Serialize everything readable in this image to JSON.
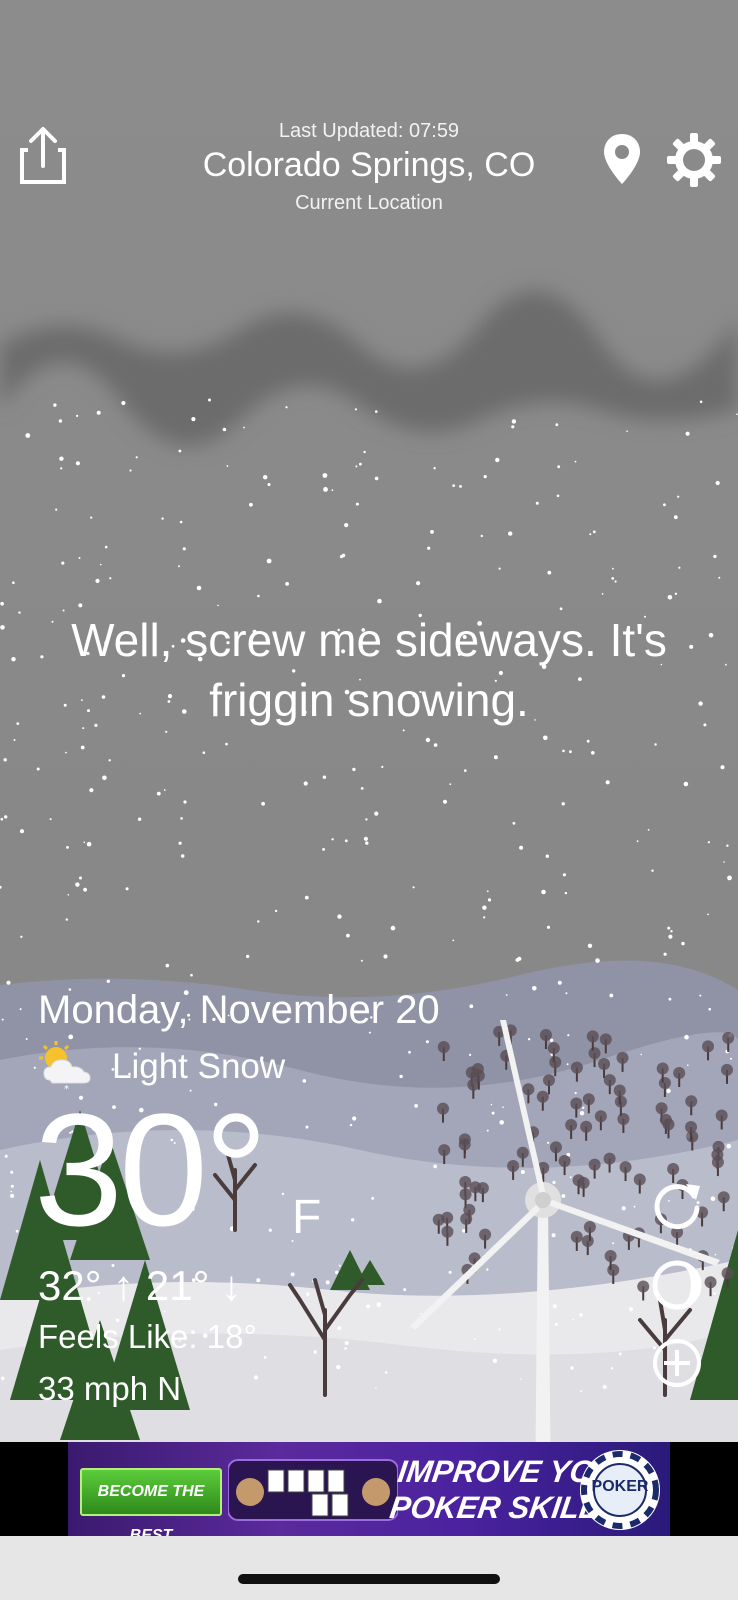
{
  "header": {
    "last_updated": "Last Updated: 07:59",
    "city": "Colorado Springs, CO",
    "location_label": "Current Location"
  },
  "icons": {
    "share": "share-icon",
    "location": "map-pin-icon",
    "settings": "gear-icon",
    "condition": "partly-cloudy-snow-icon",
    "refresh": "refresh-icon",
    "moon": "moon-icon",
    "add": "plus-circle-icon"
  },
  "quip": "Well, screw me sideways. It's friggin snowing.",
  "weather": {
    "date": "Monday, November 20",
    "condition": "Light Snow",
    "temperature": "30°",
    "unit": "F",
    "hi_lo": "32° ↑  21° ↓",
    "feels_like": "Feels Like: 18°",
    "wind": "33 mph N"
  },
  "ad": {
    "cta": "BECOME THE BEST",
    "headline_line1": "IMPROVE YOUR",
    "headline_line2": "POKER SKILLS",
    "logo_text": "POKER"
  },
  "colors": {
    "sky": "#8a8a8a",
    "clouds": "#6e6e6e",
    "hills_far": "#8e93a6",
    "snow_ground": "#e8e8e8",
    "trees": "#2f5a2a"
  }
}
